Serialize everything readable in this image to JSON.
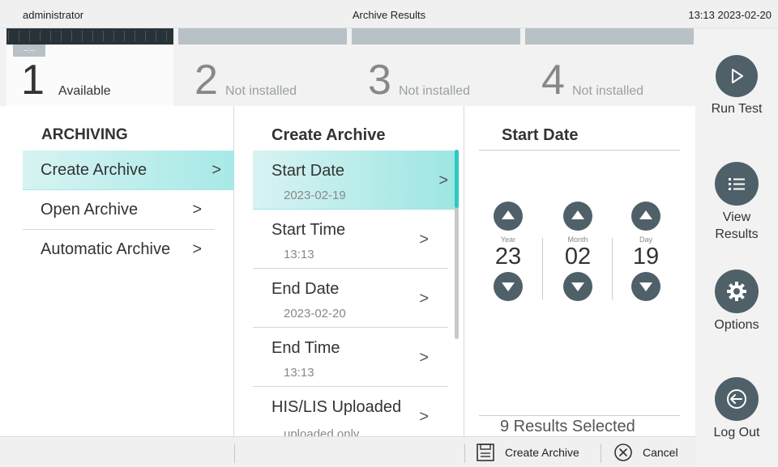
{
  "topbar": {
    "user": "administrator",
    "title": "Archive Results",
    "datetime": "13:13 2023-02-20"
  },
  "modules": [
    {
      "number": "1",
      "status": "Available",
      "badge": "--:--"
    },
    {
      "number": "2",
      "status": "Not installed"
    },
    {
      "number": "3",
      "status": "Not installed"
    },
    {
      "number": "4",
      "status": "Not installed"
    }
  ],
  "sidebar_right": {
    "run_test": "Run Test",
    "view_results_line1": "View",
    "view_results_line2": "Results",
    "options": "Options",
    "log_out": "Log Out"
  },
  "archiving": {
    "heading": "ARCHIVING",
    "items": [
      {
        "label": "Create Archive",
        "chevron": ">"
      },
      {
        "label": "Open Archive",
        "chevron": ">"
      },
      {
        "label": "Automatic Archive",
        "chevron": ">"
      }
    ]
  },
  "create_archive": {
    "heading": "Create Archive",
    "items": [
      {
        "label": "Start Date",
        "value": "2023-02-19",
        "chevron": ">"
      },
      {
        "label": "Start Time",
        "value": "13:13",
        "chevron": ">"
      },
      {
        "label": "End Date",
        "value": "2023-02-20",
        "chevron": ">"
      },
      {
        "label": "End Time",
        "value": "13:13",
        "chevron": ">"
      },
      {
        "label": "HIS/LIS Uploaded",
        "value": "uploaded only",
        "chevron": ">"
      }
    ]
  },
  "start_date": {
    "heading": "Start Date",
    "year_label": "Year",
    "year_value": "23",
    "month_label": "Month",
    "month_value": "02",
    "day_label": "Day",
    "day_value": "19",
    "results_selected": "9 Results Selected"
  },
  "bottombar": {
    "create_archive": "Create Archive",
    "cancel": "Cancel"
  },
  "colors": {
    "accent": "#2ec8c2",
    "selected_bg": "#a7e9e7",
    "icon_dark": "#4f6069",
    "module_header": "#283339"
  }
}
